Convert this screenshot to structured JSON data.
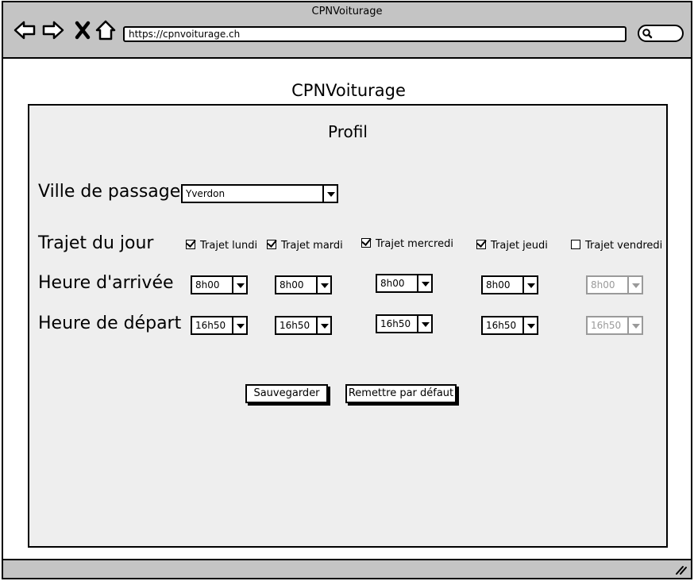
{
  "browser": {
    "window_title": "CPNVoiturage",
    "url": "https://cpnvoiturage.ch",
    "icons": [
      "back-arrow-icon",
      "forward-arrow-icon",
      "close-icon",
      "home-icon",
      "search-icon",
      "resize-grip-icon"
    ]
  },
  "page": {
    "title": "CPNVoiturage",
    "panel_title": "Profil"
  },
  "labels": {
    "city": "Ville de passage",
    "daily_trip": "Trajet du jour",
    "arrival": "Heure d'arrivée",
    "departure": "Heure de départ"
  },
  "city_select": {
    "value": "Yverdon"
  },
  "days": [
    {
      "label": "Trajet lundi",
      "checked": true,
      "arrival": "8h00",
      "departure": "16h50",
      "enabled": true
    },
    {
      "label": "Trajet mardi",
      "checked": true,
      "arrival": "8h00",
      "departure": "16h50",
      "enabled": true
    },
    {
      "label": "Trajet mercredi",
      "checked": true,
      "arrival": "8h00",
      "departure": "16h50",
      "enabled": true
    },
    {
      "label": "Trajet jeudi",
      "checked": true,
      "arrival": "8h00",
      "departure": "16h50",
      "enabled": true
    },
    {
      "label": "Trajet vendredi",
      "checked": false,
      "arrival": "8h00",
      "departure": "16h50",
      "enabled": false
    }
  ],
  "buttons": {
    "save": "Sauvegarder",
    "reset": "Remettre par défaut"
  }
}
